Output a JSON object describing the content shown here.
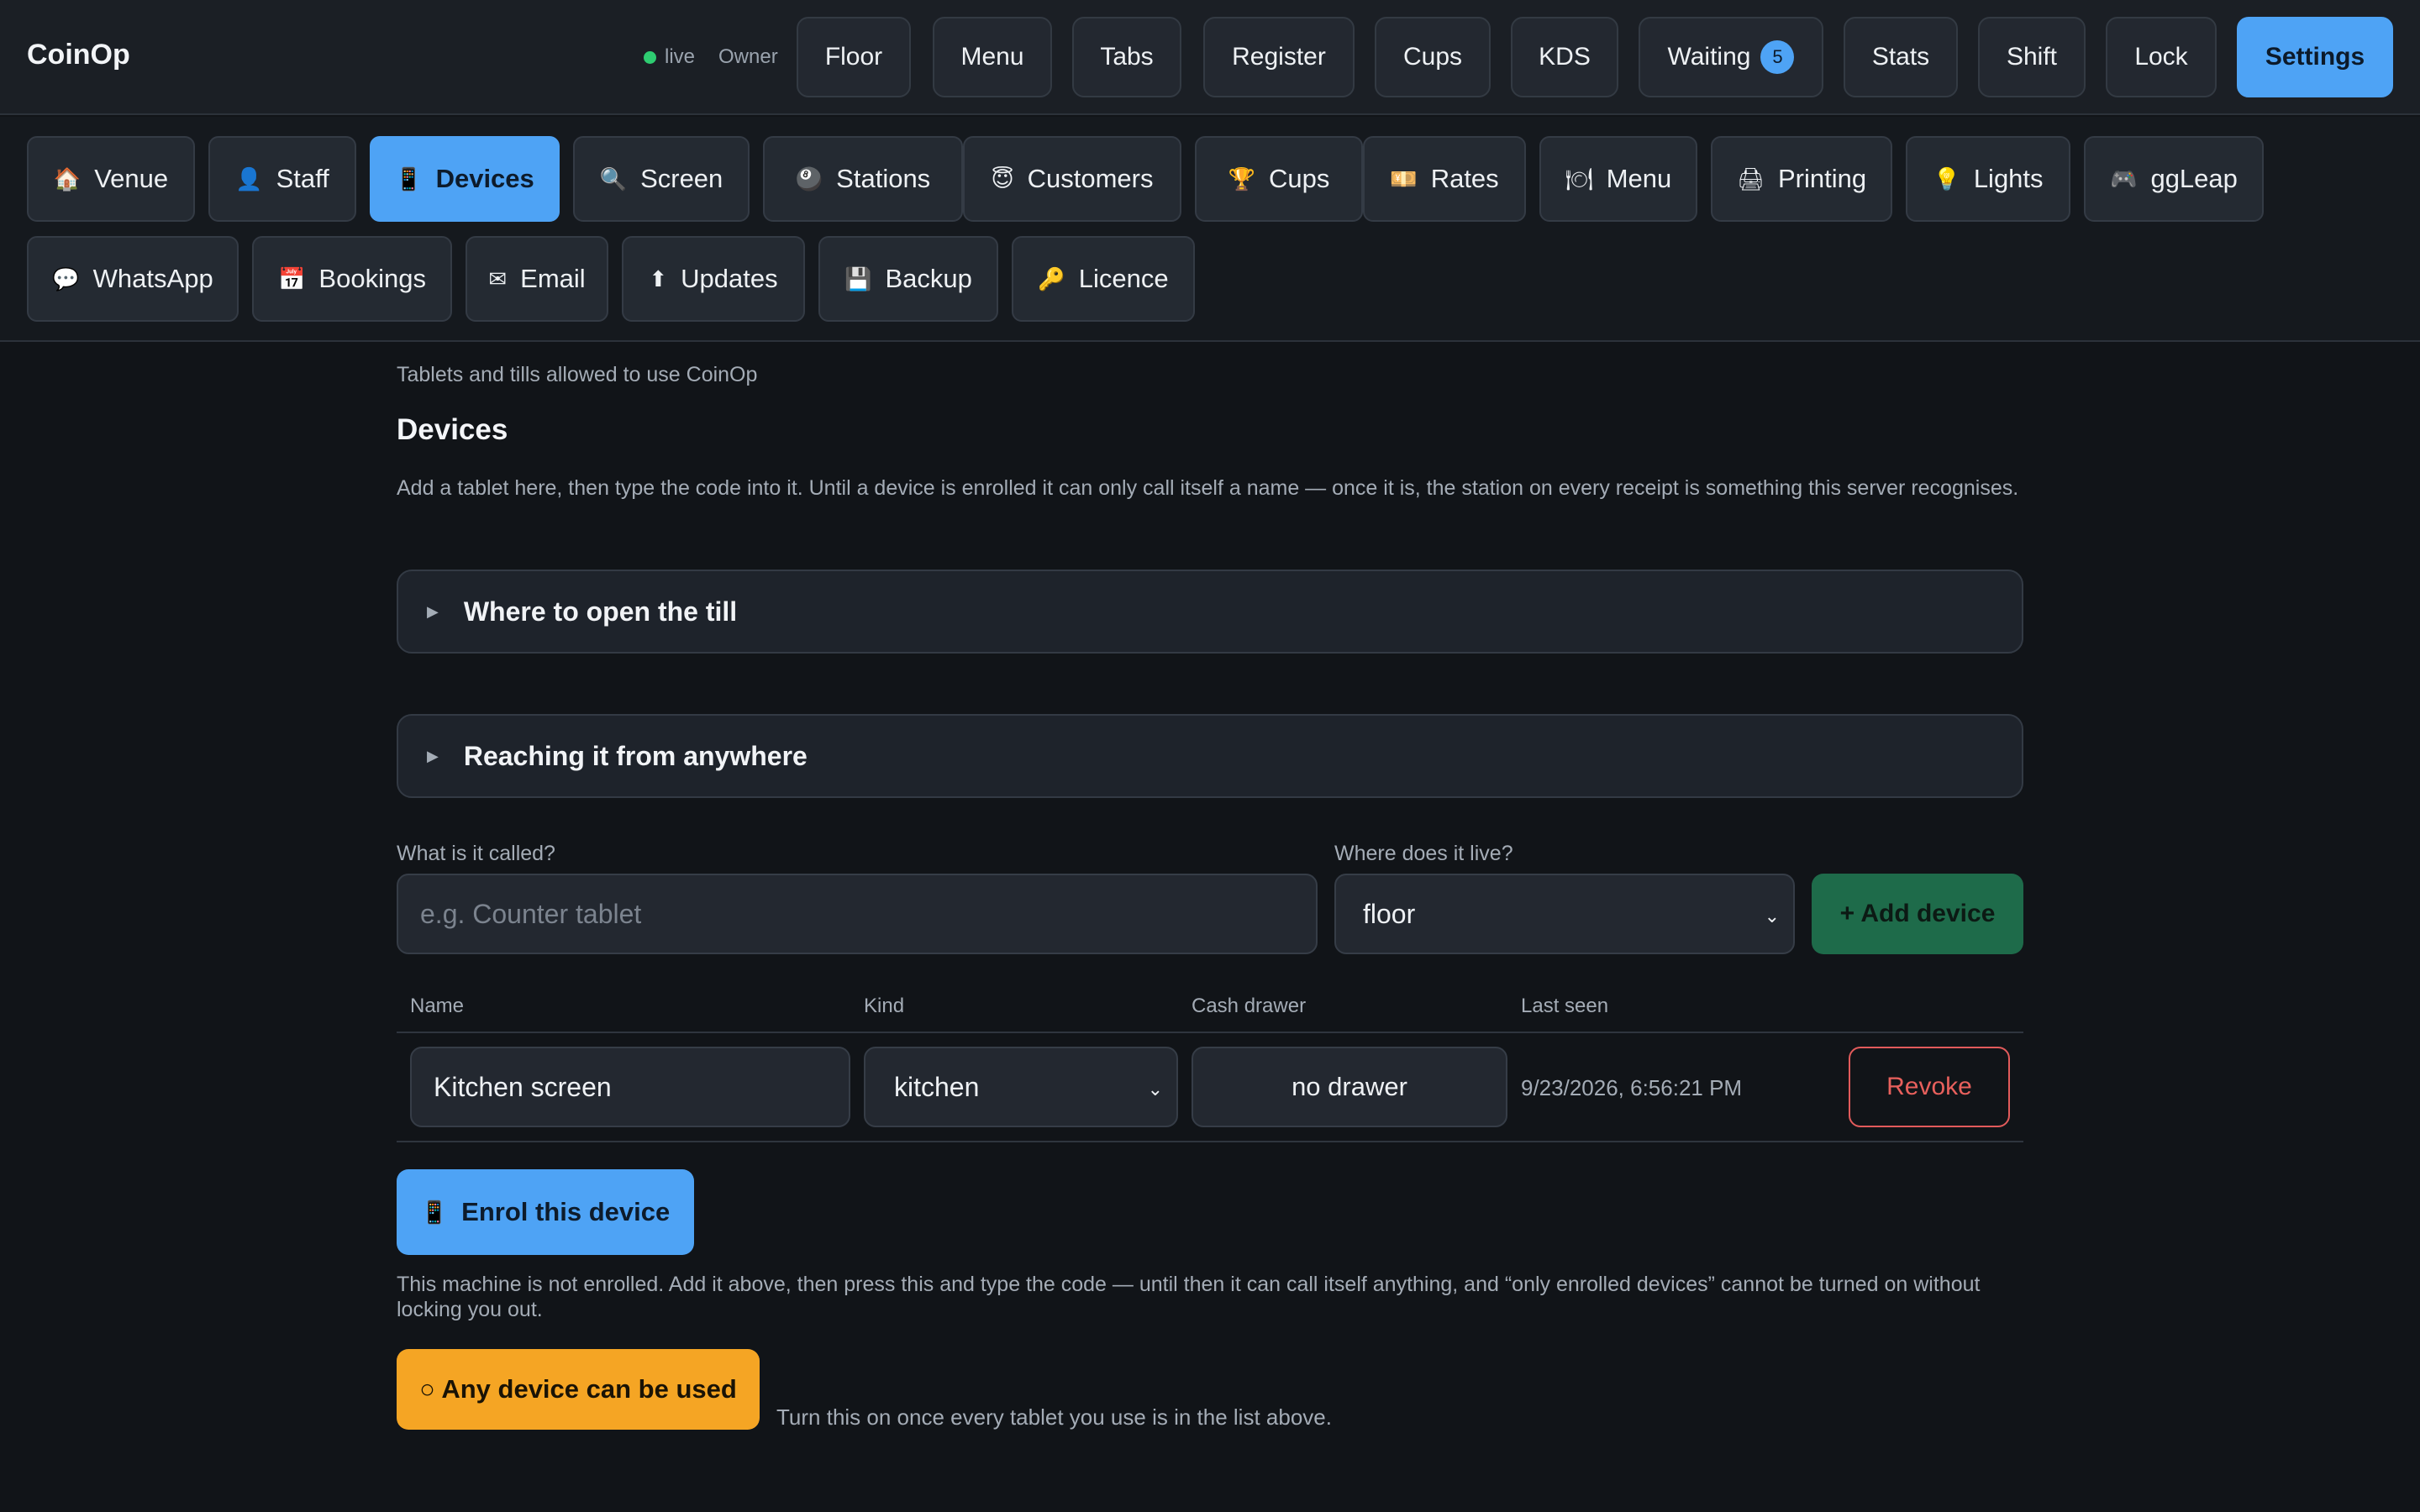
{
  "app": {
    "title": "CoinOp",
    "status": "live",
    "role": "Owner"
  },
  "topnav": [
    {
      "label": "Floor"
    },
    {
      "label": "Menu"
    },
    {
      "label": "Tabs"
    },
    {
      "label": "Register"
    },
    {
      "label": "Cups"
    },
    {
      "label": "KDS"
    },
    {
      "label": "Waiting",
      "badge": "5"
    },
    {
      "label": "Stats"
    },
    {
      "label": "Shift"
    },
    {
      "label": "Lock"
    },
    {
      "label": "Settings",
      "active": true
    }
  ],
  "settings_tabs": [
    {
      "icon": "🏠",
      "icon_name": "house-icon",
      "label": "Venue"
    },
    {
      "icon": "👤",
      "icon_name": "person-icon",
      "label": "Staff"
    },
    {
      "icon": "📱",
      "icon_name": "phone-icon",
      "label": "Devices",
      "active": true
    },
    {
      "icon": "🔍",
      "icon_name": "magnifier-icon",
      "label": "Screen"
    },
    {
      "icon": "🎱",
      "icon_name": "billiard-ball-icon",
      "label": "Stations"
    },
    {
      "icon": "😇",
      "icon_name": "smiley-icon",
      "label": "Customers"
    },
    {
      "icon": "🏆",
      "icon_name": "trophy-icon",
      "label": "Cups"
    },
    {
      "icon": "💴",
      "icon_name": "banknote-icon",
      "label": "Rates"
    },
    {
      "icon": "🍽",
      "icon_name": "plate-icon",
      "label": "Menu"
    },
    {
      "icon": "🖨",
      "icon_name": "printer-icon",
      "label": "Printing"
    },
    {
      "icon": "💡",
      "icon_name": "bulb-icon",
      "label": "Lights"
    },
    {
      "icon": "🎮",
      "icon_name": "gamepad-icon",
      "label": "ggLeap"
    },
    {
      "icon": "💬",
      "icon_name": "chat-icon",
      "label": "WhatsApp"
    },
    {
      "icon": "📅",
      "icon_name": "calendar-icon",
      "label": "Bookings"
    },
    {
      "icon": "✉",
      "icon_name": "envelope-icon",
      "label": "Email"
    },
    {
      "icon": "⬆",
      "icon_name": "up-arrow-icon",
      "label": "Updates"
    },
    {
      "icon": "💾",
      "icon_name": "floppy-icon",
      "label": "Backup"
    },
    {
      "icon": "🔑",
      "icon_name": "key-icon",
      "label": "Licence"
    }
  ],
  "page": {
    "subtitle": "Tablets and tills allowed to use CoinOp",
    "heading": "Devices",
    "description": "Add a tablet here, then type the code into it. Until a device is enrolled it can only call itself a name — once it is, the station on every receipt is something this server recognises.",
    "sections": [
      {
        "summary": "Where to open the till"
      },
      {
        "summary": "Reaching it from anywhere"
      }
    ],
    "form": {
      "name_label": "What is it called?",
      "name_placeholder": "e.g. Counter tablet",
      "where_label": "Where does it live?",
      "where_value": "floor",
      "add_label": "+ Add device"
    },
    "table": {
      "headers": [
        "Name",
        "Kind",
        "Cash drawer",
        "Last seen"
      ],
      "rows": [
        {
          "name": "Kitchen screen",
          "kind": "kitchen",
          "drawer": "no drawer",
          "last_seen": "9/23/2026, 6:56:21 PM",
          "action": "Revoke"
        }
      ]
    },
    "enrol": {
      "icon": "📱",
      "label": "Enrol this device",
      "note": "This machine is not enrolled. Add it above, then press this and type the code — until then it can call itself anything, and “only enrolled devices” cannot be turned on without locking you out."
    },
    "any_device": {
      "label": "○ Any device can be used",
      "note": "Turn this on once every tablet you use is in the list above."
    }
  }
}
